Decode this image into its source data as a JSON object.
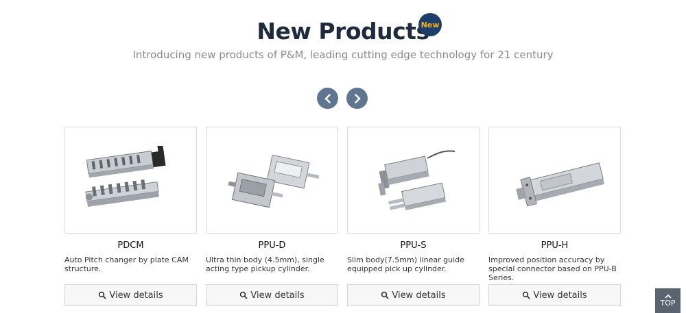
{
  "header": {
    "title": "New Products",
    "badge": "New",
    "subtitle": "Introducing new products of P&M, leading cutting edge technology for 21 century"
  },
  "carousel": {
    "prev_icon": "chevron-left-icon",
    "next_icon": "chevron-right-icon"
  },
  "products": [
    {
      "name": "PDCM",
      "description": "Auto Pitch changer by plate CAM structure.",
      "button": "View details"
    },
    {
      "name": "PPU-D",
      "description": "Ultra thin body (4.5mm), single acting type pickup cylinder.",
      "button": "View details"
    },
    {
      "name": "PPU-S",
      "description": "Slim body(7.5mm) linear guide equipped pick up cylinder.",
      "button": "View details"
    },
    {
      "name": "PPU-H",
      "description": "Improved position accuracy by special connector based on PPU-B Series.",
      "button": "View details"
    }
  ],
  "top_button": {
    "label": "TOP"
  },
  "colors": {
    "title": "#1f2a3c",
    "badge_bg": "#1e3d68",
    "badge_text": "#f3b327",
    "nav_button": "#5f7590",
    "top_button": "#5a6470"
  }
}
